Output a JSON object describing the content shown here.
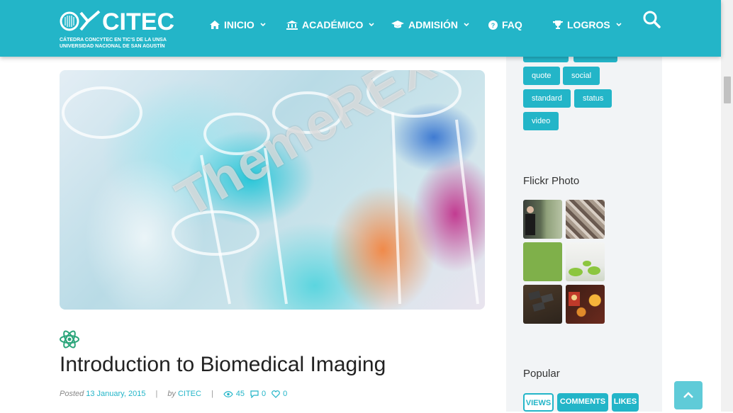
{
  "brand": {
    "name": "CITEC",
    "subtitle_line1": "CÁTEDRA CONCYTEC EN TIC'S DE LA UNSA",
    "subtitle_line2": "UNIVERSIDAD NACIONAL DE SAN AGUSTÍN",
    "color": "#23b5c8"
  },
  "nav": {
    "items": [
      {
        "label": "INICIO",
        "icon": "home-icon"
      },
      {
        "label": "ACADÉMICO",
        "icon": "bank-icon"
      },
      {
        "label": "ADMISIÓN",
        "icon": "graduation-cap-icon"
      },
      {
        "label": "FAQ",
        "icon": "question-icon"
      },
      {
        "label": "LOGROS",
        "icon": "trophy-icon"
      }
    ],
    "search_icon": "search-icon"
  },
  "post": {
    "image_watermark": "ThemeREX",
    "category_icon": "atom-icon",
    "title": "Introduction to Biomedical Imaging",
    "posted_label": "Posted",
    "date": "13 January, 2015",
    "by_label": "by",
    "author": "CITEC",
    "views": "45",
    "comments": "0",
    "likes": "0"
  },
  "sidebar": {
    "tags": [
      "quote",
      "social",
      "standard",
      "status",
      "video"
    ],
    "flickr_title": "Flickr Photo",
    "popular_title": "Popular",
    "tabs": [
      "VIEWS",
      "COMMENTS",
      "LIKES"
    ]
  }
}
